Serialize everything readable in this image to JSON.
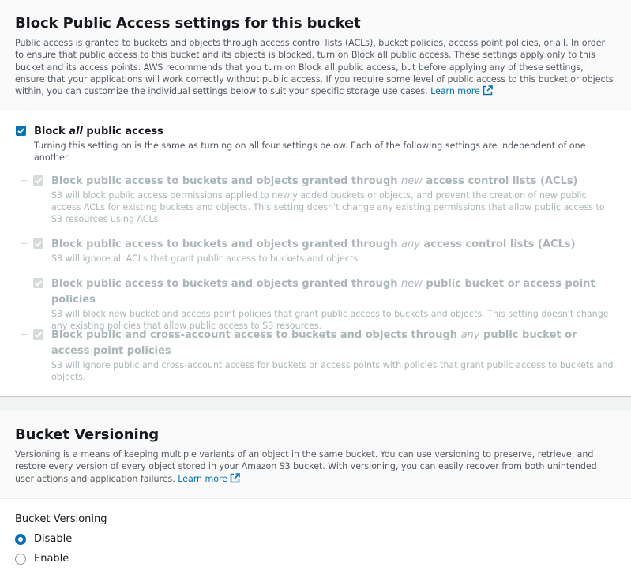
{
  "bpa": {
    "title": "Block Public Access settings for this bucket",
    "description": "Public access is granted to buckets and objects through access control lists (ACLs), bucket policies, access point policies, or all. In order to ensure that public access to this bucket and its objects is blocked, turn on Block all public access. These settings apply only to this bucket and its access points. AWS recommends that you turn on Block all public access, but before applying any of these settings, ensure that your applications will work correctly without public access. If you require some level of public access to this bucket or objects within, you can customize the individual settings below to suit your specific storage use cases.",
    "learn_more": "Learn more",
    "master": {
      "label_pre": "Block ",
      "label_em": "all",
      "label_post": " public access",
      "checked": true,
      "description": "Turning this setting on is the same as turning on all four settings below. Each of the following settings are independent of one another."
    },
    "options": [
      {
        "label_pre": "Block public access to buckets and objects granted through ",
        "label_em": "new",
        "label_post": " access control lists (ACLs)",
        "description": "S3 will block public access permissions applied to newly added buckets or objects, and prevent the creation of new public access ACLs for existing buckets and objects. This setting doesn't change any existing permissions that allow public access to S3 resources using ACLs.",
        "checked": true
      },
      {
        "label_pre": "Block public access to buckets and objects granted through ",
        "label_em": "any",
        "label_post": " access control lists (ACLs)",
        "description": "S3 will ignore all ACLs that grant public access to buckets and objects.",
        "checked": true
      },
      {
        "label_pre": "Block public access to buckets and objects granted through ",
        "label_em": "new",
        "label_post": " public bucket or access point policies",
        "description": "S3 will block new bucket and access point policies that grant public access to buckets and objects. This setting doesn't change any existing policies that allow public access to S3 resources.",
        "checked": true
      },
      {
        "label_pre": "Block public and cross-account access to buckets and objects through ",
        "label_em": "any",
        "label_post": " public bucket or access point policies",
        "description": "S3 will ignore public and cross-account access for buckets or access points with policies that grant public access to buckets and objects.",
        "checked": true
      }
    ]
  },
  "versioning": {
    "title": "Bucket Versioning",
    "description": "Versioning is a means of keeping multiple variants of an object in the same bucket. You can use versioning to preserve, retrieve, and restore every version of every object stored in your Amazon S3 bucket. With versioning, you can easily recover from both unintended user actions and application failures.",
    "learn_more": "Learn more",
    "field_label": "Bucket Versioning",
    "options": [
      {
        "label": "Disable",
        "selected": true
      },
      {
        "label": "Enable",
        "selected": false
      }
    ]
  },
  "colors": {
    "accent": "#0073bb",
    "disabled": "#aab7b8"
  }
}
